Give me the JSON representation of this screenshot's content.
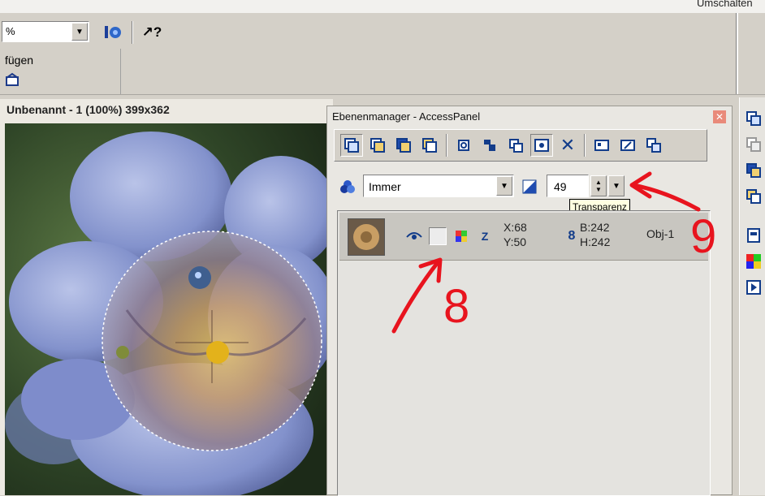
{
  "top_right_text": "Umschalten",
  "toolbar": {
    "zoom_value": "%",
    "paste_label": "fügen"
  },
  "document": {
    "title": "Unbenannt - 1 (100%) 399x362"
  },
  "layer_panel": {
    "title": "Ebenenmanager - AccessPanel",
    "blend_mode": "Immer",
    "transparency_value": "49",
    "tooltip": "Transparenz",
    "layer": {
      "x": "X:68",
      "y": "Y:50",
      "width": "B:242",
      "height": "H:242",
      "name": "Obj-1"
    }
  },
  "annotations": {
    "label_8": "8",
    "label_9": "9",
    "color": "#e8141e"
  }
}
